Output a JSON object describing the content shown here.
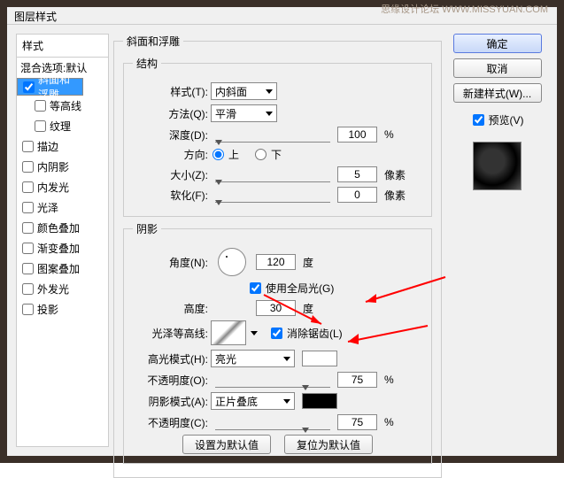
{
  "window": {
    "title": "图层样式"
  },
  "watermark": "思缘设计论坛 WWW.MISSYUAN.COM",
  "buttons": {
    "ok": "确定",
    "cancel": "取消",
    "newstyle": "新建样式(W)...",
    "preview": "预览(V)",
    "default": "设置为默认值",
    "reset": "复位为默认值"
  },
  "sidebar": {
    "head": "样式",
    "blend": "混合选项:默认",
    "items": [
      "斜面和浮雕",
      "等高线",
      "纹理",
      "描边",
      "内阴影",
      "内发光",
      "光泽",
      "颜色叠加",
      "渐变叠加",
      "图案叠加",
      "外发光",
      "投影"
    ]
  },
  "bevel": {
    "title": "斜面和浮雕",
    "structure": "结构",
    "style_l": "样式(T):",
    "style_v": "内斜面",
    "tech_l": "方法(Q):",
    "tech_v": "平滑",
    "depth_l": "深度(D):",
    "depth_v": "100",
    "pct": "%",
    "dir_l": "方向:",
    "up": "上",
    "down": "下",
    "size_l": "大小(Z):",
    "size_v": "5",
    "px": "像素",
    "soften_l": "软化(F):",
    "soften_v": "0"
  },
  "shadow": {
    "title": "阴影",
    "angle_l": "角度(N):",
    "angle_v": "120",
    "deg": "度",
    "global": "使用全局光(G)",
    "alt_l": "高度:",
    "alt_v": "30",
    "gloss_l": "光泽等高线:",
    "anti": "消除锯齿(L)",
    "hilite_l": "高光模式(H):",
    "hilite_v": "亮光",
    "opac_l": "不透明度(O):",
    "opac_v": "75",
    "shadow_l": "阴影模式(A):",
    "shadow_v": "正片叠底",
    "opac2_l": "不透明度(C):",
    "opac2_v": "75"
  }
}
